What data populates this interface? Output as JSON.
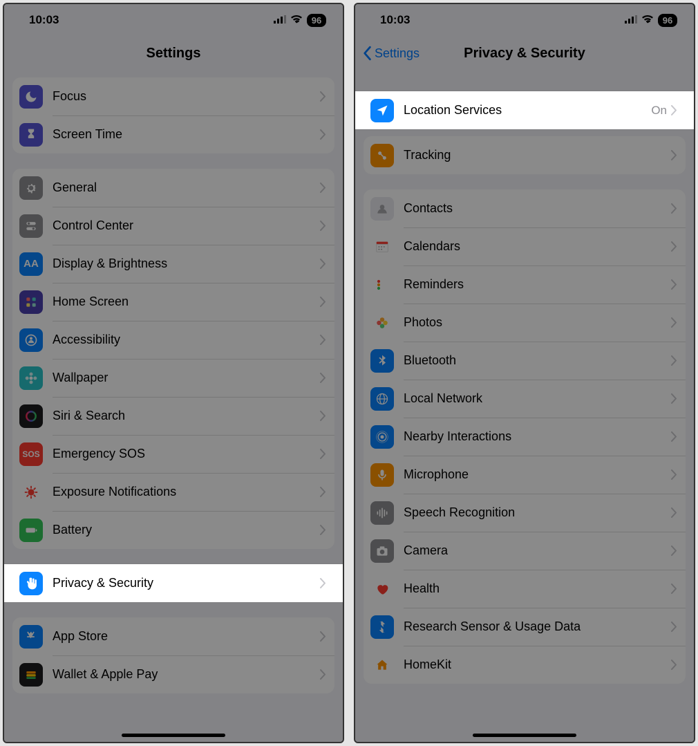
{
  "status": {
    "time": "10:03",
    "battery": "96"
  },
  "left": {
    "title": "Settings",
    "groups": [
      {
        "rows": [
          {
            "id": "focus",
            "label": "Focus",
            "icon": "#5856d6",
            "glyph": "moon"
          },
          {
            "id": "screen-time",
            "label": "Screen Time",
            "icon": "#5856d6",
            "glyph": "hourglass"
          }
        ]
      },
      {
        "rows": [
          {
            "id": "general",
            "label": "General",
            "icon": "#8e8e93",
            "glyph": "gear"
          },
          {
            "id": "control-center",
            "label": "Control Center",
            "icon": "#8e8e93",
            "glyph": "switches"
          },
          {
            "id": "display",
            "label": "Display & Brightness",
            "icon": "#0a84ff",
            "glyph": "aa"
          },
          {
            "id": "home-screen",
            "label": "Home Screen",
            "icon": "#4b3fae",
            "glyph": "grid"
          },
          {
            "id": "accessibility",
            "label": "Accessibility",
            "icon": "#0a84ff",
            "glyph": "person"
          },
          {
            "id": "wallpaper",
            "label": "Wallpaper",
            "icon": "#29c5c9",
            "glyph": "flower"
          },
          {
            "id": "siri",
            "label": "Siri & Search",
            "icon": "#1c1c1e",
            "glyph": "siri"
          },
          {
            "id": "emergency",
            "label": "Emergency SOS",
            "icon": "#ff3b30",
            "glyph": "sos"
          },
          {
            "id": "exposure",
            "label": "Exposure Notifications",
            "icon": "#ffffff",
            "glyph": "covid"
          },
          {
            "id": "battery",
            "label": "Battery",
            "icon": "#34c759",
            "glyph": "battery"
          },
          {
            "id": "privacy",
            "label": "Privacy & Security",
            "icon": "#0a84ff",
            "glyph": "hand",
            "highlight": true
          }
        ]
      },
      {
        "rows": [
          {
            "id": "app-store",
            "label": "App Store",
            "icon": "#0a84ff",
            "glyph": "appstore"
          },
          {
            "id": "wallet",
            "label": "Wallet & Apple Pay",
            "icon": "#1c1c1e",
            "glyph": "wallet"
          }
        ]
      }
    ]
  },
  "right": {
    "back": "Settings",
    "title": "Privacy & Security",
    "groups": [
      {
        "rows": [
          {
            "id": "location",
            "label": "Location Services",
            "value": "On",
            "icon": "#0a84ff",
            "glyph": "location",
            "highlight": true
          },
          {
            "id": "tracking",
            "label": "Tracking",
            "icon": "#ff9500",
            "glyph": "tracking"
          }
        ]
      },
      {
        "rows": [
          {
            "id": "contacts",
            "label": "Contacts",
            "icon": "#e9e9ee",
            "glyph": "contacts"
          },
          {
            "id": "calendars",
            "label": "Calendars",
            "icon": "#ffffff",
            "glyph": "calendar"
          },
          {
            "id": "reminders",
            "label": "Reminders",
            "icon": "#ffffff",
            "glyph": "reminders"
          },
          {
            "id": "photos",
            "label": "Photos",
            "icon": "#ffffff",
            "glyph": "photos"
          },
          {
            "id": "bluetooth",
            "label": "Bluetooth",
            "icon": "#0a84ff",
            "glyph": "bluetooth"
          },
          {
            "id": "local-network",
            "label": "Local Network",
            "icon": "#0a84ff",
            "glyph": "globe"
          },
          {
            "id": "nearby",
            "label": "Nearby Interactions",
            "icon": "#0a84ff",
            "glyph": "nearby"
          },
          {
            "id": "microphone",
            "label": "Microphone",
            "icon": "#ff9500",
            "glyph": "mic"
          },
          {
            "id": "speech",
            "label": "Speech Recognition",
            "icon": "#8e8e93",
            "glyph": "wave"
          },
          {
            "id": "camera",
            "label": "Camera",
            "icon": "#8e8e93",
            "glyph": "camera"
          },
          {
            "id": "health",
            "label": "Health",
            "icon": "#ffffff",
            "glyph": "heart"
          },
          {
            "id": "research",
            "label": "Research Sensor & Usage Data",
            "icon": "#0a84ff",
            "glyph": "research"
          },
          {
            "id": "homekit",
            "label": "HomeKit",
            "icon": "#ffffff",
            "glyph": "home"
          }
        ]
      }
    ]
  }
}
